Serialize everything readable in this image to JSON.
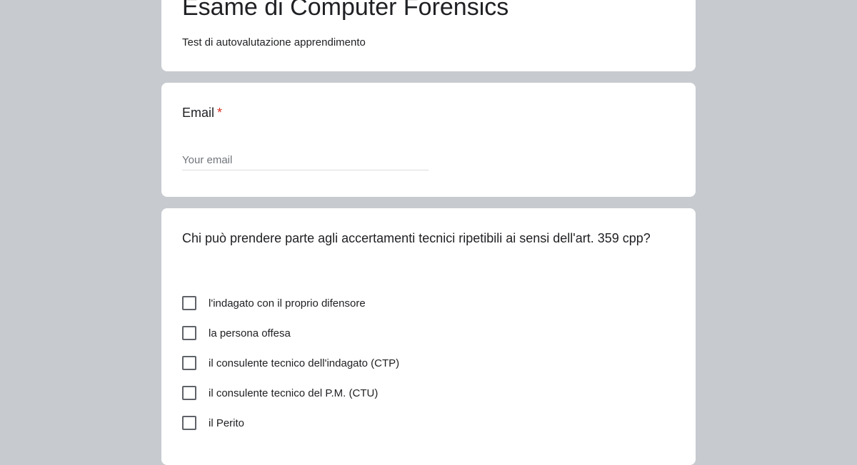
{
  "form": {
    "title": "Esame di Computer Forensics",
    "description": "Test di autovalutazione apprendimento"
  },
  "email": {
    "label": "Email",
    "required_mark": "*",
    "placeholder": "Your email"
  },
  "question": {
    "text": "Chi può prendere parte agli accertamenti tecnici ripetibili ai sensi dell'art. 359 cpp?",
    "options": [
      "l'indagato con il proprio difensore",
      "la persona offesa",
      "il consulente tecnico dell'indagato (CTP)",
      "il consulente tecnico del P.M. (CTU)",
      "il Perito"
    ]
  },
  "colors": {
    "page_background": "#c7cbd0",
    "card_background": "#ffffff",
    "required": "#d93025",
    "checkbox_border": "#5f6368"
  }
}
